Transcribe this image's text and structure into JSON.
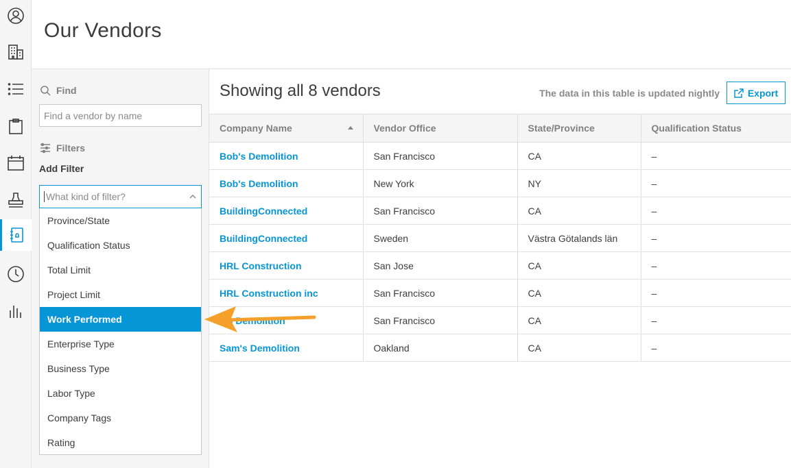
{
  "page": {
    "title": "Our Vendors"
  },
  "rail": {
    "items": [
      {
        "icon": "user-circle-icon",
        "active": false
      },
      {
        "icon": "building-icon",
        "active": false
      },
      {
        "icon": "list-icon",
        "active": false
      },
      {
        "icon": "clipboard-icon",
        "active": false
      },
      {
        "icon": "calendar-icon",
        "active": false
      },
      {
        "icon": "stamp-icon",
        "active": false
      },
      {
        "icon": "vendor-directory-icon",
        "active": true
      },
      {
        "icon": "clock-icon",
        "active": false
      },
      {
        "icon": "bar-chart-icon",
        "active": false
      }
    ]
  },
  "filters": {
    "find_label": "Find",
    "search_placeholder": "Find a vendor by name",
    "filters_label": "Filters",
    "add_filter_label": "Add Filter",
    "filter_placeholder": "What kind of filter?",
    "options": [
      "Province/State",
      "Qualification Status",
      "Total Limit",
      "Project Limit",
      "Work Performed",
      "Enterprise Type",
      "Business Type",
      "Labor Type",
      "Company Tags",
      "Rating"
    ],
    "selected_option": "Work Performed"
  },
  "table": {
    "showing": "Showing all 8 vendors",
    "note": "The data in this table is updated nightly",
    "export_label": "Export",
    "columns": [
      "Company Name",
      "Vendor Office",
      "State/Province",
      "Qualification Status"
    ],
    "rows": [
      [
        "Bob's Demolition",
        "San Francisco",
        "CA",
        "–"
      ],
      [
        "Bob's Demolition",
        "New York",
        "NY",
        "–"
      ],
      [
        "BuildingConnected",
        "San Francisco",
        "CA",
        "–"
      ],
      [
        "BuildingConnected",
        "Sweden",
        "Västra Götalands län",
        "–"
      ],
      [
        "HRL Construction",
        "San Jose",
        "CA",
        "–"
      ],
      [
        "HRL Construction inc",
        "San Francisco",
        "CA",
        "–"
      ],
      [
        "...s Demolition",
        "San Francisco",
        "CA",
        "–"
      ],
      [
        "Sam's Demolition",
        "Oakland",
        "CA",
        "–"
      ]
    ]
  },
  "colors": {
    "accent": "#0696d7",
    "annotation": "#f5a02a"
  }
}
